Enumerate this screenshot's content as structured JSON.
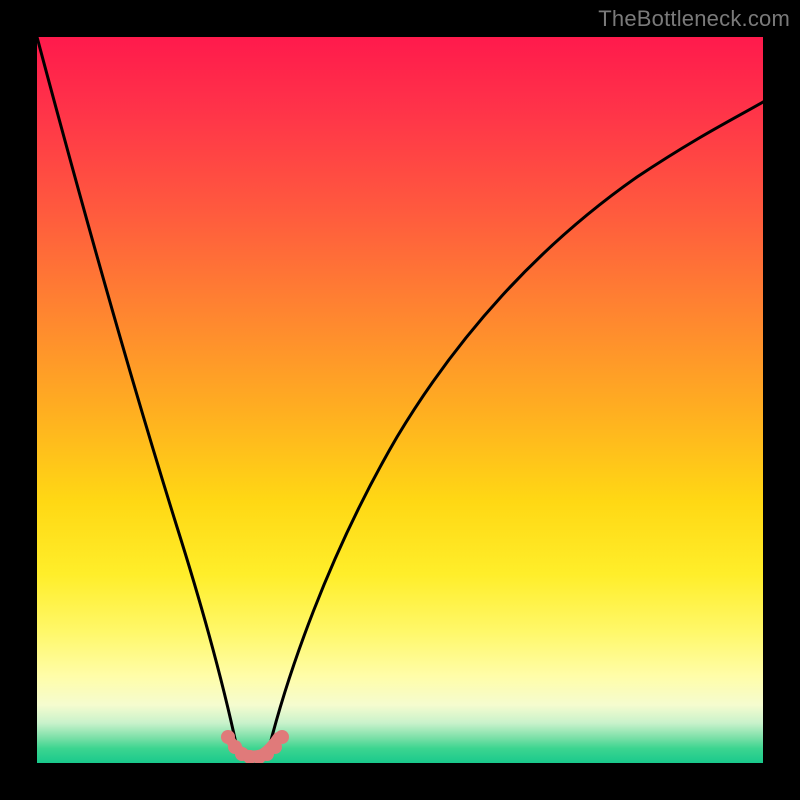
{
  "attribution": "TheBottleneck.com",
  "colors": {
    "gradient_top": "#ff1a4c",
    "gradient_mid": "#ffd814",
    "gradient_bottom": "#19c98c",
    "curve": "#000000",
    "markers": "#e07a7a",
    "background": "#000000"
  },
  "chart_data": {
    "type": "line",
    "title": "",
    "xlabel": "",
    "ylabel": "",
    "xlim": [
      0,
      100
    ],
    "ylim": [
      0,
      100
    ],
    "grid": false,
    "legend": false,
    "series": [
      {
        "name": "left-branch",
        "x": [
          0,
          2,
          4,
          6,
          8,
          10,
          12,
          14,
          16,
          18,
          20,
          22,
          24,
          26,
          27.5
        ],
        "y": [
          100,
          92,
          84,
          76,
          68,
          60,
          52,
          44,
          37,
          30,
          23,
          17,
          11,
          6,
          2
        ]
      },
      {
        "name": "right-branch",
        "x": [
          32,
          34,
          36,
          38,
          40,
          44,
          48,
          52,
          56,
          60,
          66,
          72,
          80,
          88,
          96,
          100
        ],
        "y": [
          2,
          6,
          11,
          17,
          23,
          33,
          42,
          49,
          56,
          62,
          69,
          74,
          80,
          85,
          89,
          91
        ]
      }
    ],
    "annotations": [
      {
        "name": "trough-markers",
        "type": "scatter",
        "color": "#e07a7a",
        "x": [
          26.3,
          27.2,
          28.2,
          29.4,
          30.6,
          31.7,
          32.8,
          33.8
        ],
        "y": [
          3.6,
          2.2,
          1.3,
          0.9,
          0.9,
          1.3,
          2.2,
          3.6
        ]
      }
    ]
  }
}
